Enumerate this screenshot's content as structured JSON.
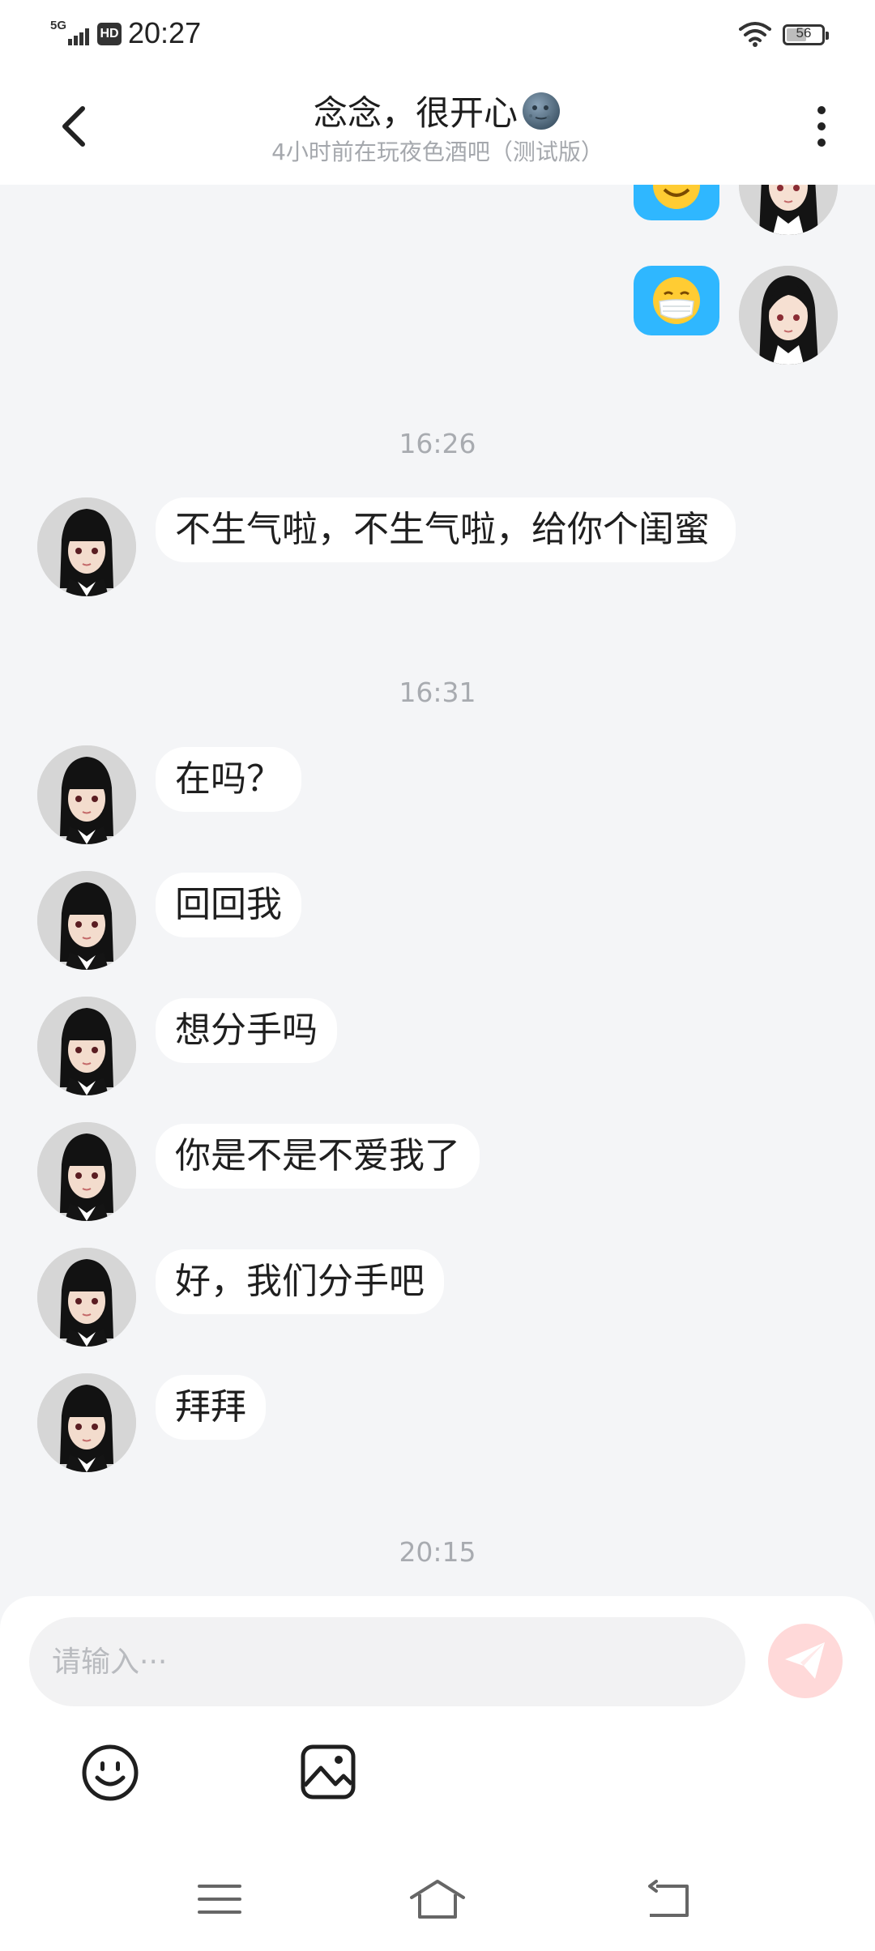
{
  "status_bar": {
    "network": "5G",
    "hd_label": "HD",
    "time": "20:27",
    "battery_level": 56,
    "battery_text": "56"
  },
  "header": {
    "title": "念念，很开心",
    "title_emoji": "new-moon-face-icon",
    "subtitle": "4小时前在玩夜色酒吧（测试版）"
  },
  "messages": {
    "time_1626": "16:26",
    "msg1": "不生气啦，不生气啦，给你个闺蜜",
    "time_1631": "16:31",
    "msg2": "在吗？",
    "msg3": "回回我",
    "msg4": "想分手吗",
    "msg5": "你是不是不爱我了",
    "msg6": "好，我们分手吧",
    "msg7": "拜拜",
    "time_2015": "20:15"
  },
  "sent_stickers": [
    "smiling-face-icon",
    "face-with-mask-icon"
  ],
  "input": {
    "placeholder": "请输入···",
    "value": ""
  },
  "colors": {
    "background": "#f4f5f7",
    "sticker_bubble": "#2fb7ff",
    "send_button": "#ffd9d9",
    "timestamp": "#a8abb0"
  }
}
